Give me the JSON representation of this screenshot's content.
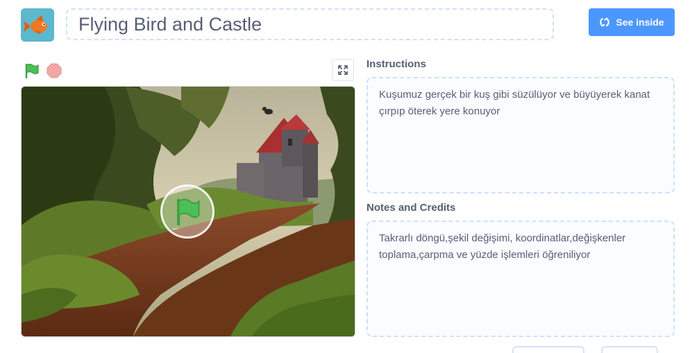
{
  "project": {
    "title": "Flying Bird and Castle",
    "thumbnail_icon": "goldfish-sprite"
  },
  "header": {
    "see_inside_label": "See inside",
    "see_inside_icon": "remix-arrows-icon",
    "button_color": "#4c97ff"
  },
  "player": {
    "green_flag_icon": "green-flag-icon",
    "stop_icon": "stop-sign-icon",
    "fullscreen_icon": "fullscreen-icon",
    "overlay_icon": "green-flag-icon"
  },
  "instructions": {
    "label": "Instructions",
    "text": "Kuşumuz gerçek bir kuş gibi süzülüyor ve büyüyerek kanat çırpıp öterek yere konuyor"
  },
  "notes": {
    "label": "Notes and Credits",
    "text": "Takrarlı döngü,şekil değişimi, koordinatlar,değişkenler toplama,çarpma ve yüzde işlemleri öğreniliyor"
  }
}
